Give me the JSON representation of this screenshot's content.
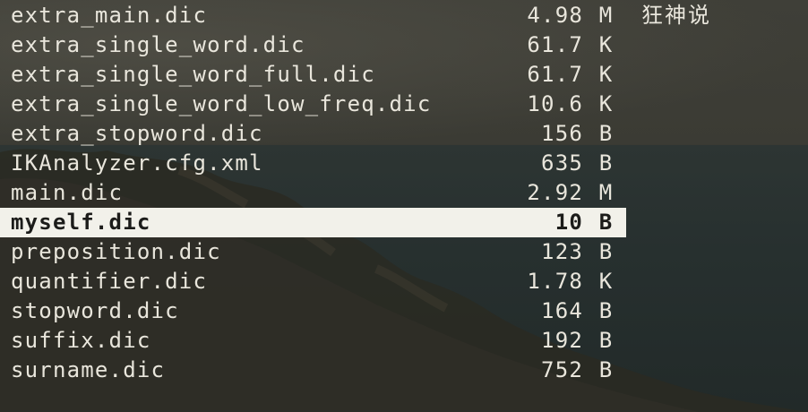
{
  "header": {
    "title": "狂神说"
  },
  "files": [
    {
      "name": "extra_main.dic",
      "size": "4.98",
      "unit": "M",
      "selected": false
    },
    {
      "name": "extra_single_word.dic",
      "size": "61.7",
      "unit": "K",
      "selected": false
    },
    {
      "name": "extra_single_word_full.dic",
      "size": "61.7",
      "unit": "K",
      "selected": false
    },
    {
      "name": "extra_single_word_low_freq.dic",
      "size": "10.6",
      "unit": "K",
      "selected": false
    },
    {
      "name": "extra_stopword.dic",
      "size": "156",
      "unit": "B",
      "selected": false
    },
    {
      "name": "IKAnalyzer.cfg.xml",
      "size": "635",
      "unit": "B",
      "selected": false
    },
    {
      "name": "main.dic",
      "size": "2.92",
      "unit": "M",
      "selected": false
    },
    {
      "name": "myself.dic",
      "size": "10",
      "unit": "B",
      "selected": true
    },
    {
      "name": "preposition.dic",
      "size": "123",
      "unit": "B",
      "selected": false
    },
    {
      "name": "quantifier.dic",
      "size": "1.78",
      "unit": "K",
      "selected": false
    },
    {
      "name": "stopword.dic",
      "size": "164",
      "unit": "B",
      "selected": false
    },
    {
      "name": "suffix.dic",
      "size": "192",
      "unit": "B",
      "selected": false
    },
    {
      "name": "surname.dic",
      "size": "752",
      "unit": "B",
      "selected": false
    }
  ],
  "colors": {
    "text": "#e9e6dc",
    "selected_background": "#f2f1ea",
    "selected_text": "#1c1c1a"
  }
}
